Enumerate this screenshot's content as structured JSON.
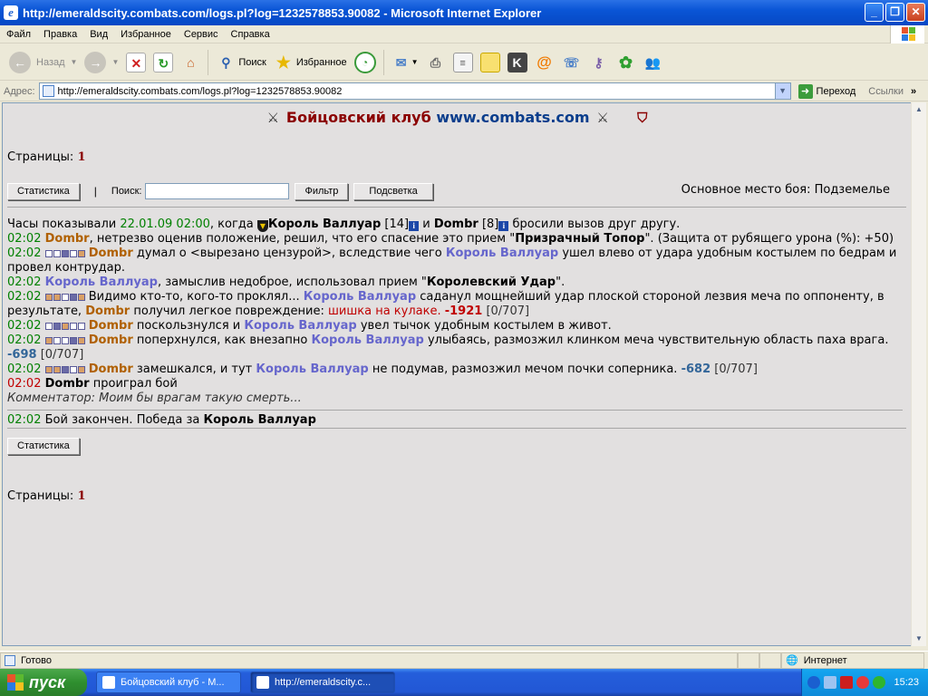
{
  "window": {
    "title": "http://emeraldscity.combats.com/logs.pl?log=1232578853.90082 - Microsoft Internet Explorer",
    "minimize": "_",
    "maximize": "❐",
    "close": "✕"
  },
  "menu": [
    "Файл",
    "Правка",
    "Вид",
    "Избранное",
    "Сервис",
    "Справка"
  ],
  "toolbar": {
    "back": "Назад",
    "search": "Поиск",
    "favorites": "Избранное"
  },
  "address": {
    "label": "Адрес:",
    "url": "http://emeraldscity.combats.com/logs.pl?log=1232578853.90082",
    "go": "Переход",
    "links": "Ссылки"
  },
  "page": {
    "header_club": "Бойцовский клуб",
    "header_site": "www.combats.com",
    "pages_label": "Страницы:",
    "pages_num": "1",
    "stats_button": "Статистика",
    "divider": "|",
    "search_label": "Поиск:",
    "search_value": "",
    "filter_button": "Фильтр",
    "highlight_button": "Подсветка",
    "place": "Основное место боя: Подземелье",
    "stats_button_bottom": "Статистика",
    "pages_label_bottom": "Страницы:",
    "pages_num_bottom": "1"
  },
  "log": {
    "intro": {
      "t1": "Часы показывали",
      "date": "22.01.09 02:00",
      "t2": ", когда",
      "player1": "Король Валлуар",
      "lvl1": "[14]",
      "and": "и",
      "player2": "Dombr",
      "lvl2": "[8]",
      "t3": "бросили вызов друг другу."
    },
    "l1": {
      "time": "02:02",
      "actor": "Dombr",
      "t1": ", нетрезво оценив положение, решил, что его спасение это прием \"",
      "skill": "Призрачный Топор",
      "t2": "\". (Защита от рубящего урона (%): +50)"
    },
    "l2": {
      "time": "02:02",
      "actor": "Dombr",
      "t1": "думал о <вырезано цензурой>, вследствие чего",
      "target": "Король Валлуар",
      "t2": "ушел влево от удара удобным костылем по бедрам и провел контрудар."
    },
    "l3": {
      "time": "02:02",
      "actor": "Король Валлуар",
      "t1": ", замыслив недоброе, использовал прием \"",
      "skill": "Королевский Удар",
      "t2": "\"."
    },
    "l4": {
      "time": "02:02",
      "t1": "Видимо кто-то, кого-то проклял...",
      "actor": "Король Валлуар",
      "t2": "саданул мощнейший удар плоской стороной лезвия меча по оппоненту, в результате,",
      "target": "Dombr",
      "t3": "получил легкое повреждение:",
      "injury": "шишка на кулаке.",
      "dmg": "-1921",
      "hp": "[0/707]"
    },
    "l5": {
      "time": "02:02",
      "actor": "Dombr",
      "t1": "поскользнулся и",
      "target": "Король Валлуар",
      "t2": "увел тычок удобным костылем в живот."
    },
    "l6": {
      "time": "02:02",
      "actor": "Dombr",
      "t1": "поперхнулся, как внезапно",
      "target": "Король Валлуар",
      "t2": "улыбаясь, размозжил клинком меча чувствительную область паха врага.",
      "dmg": "-698",
      "hp": "[0/707]"
    },
    "l7": {
      "time": "02:02",
      "actor": "Dombr",
      "t1": "замешкался, и тут",
      "target": "Король Валлуар",
      "t2": "не подумав, размозжил мечом почки соперника.",
      "dmg": "-682",
      "hp": "[0/707]"
    },
    "l8": {
      "time": "02:02",
      "actor": "Dombr",
      "t1": "проиграл бой"
    },
    "comment": "Комментатор: Моим бы врагам такую смерть...",
    "end": {
      "time": "02:02",
      "t1": "Бой закончен. Победа за",
      "winner": "Король Валлуар"
    }
  },
  "status": {
    "ready": "Готово",
    "zone": "Интернет"
  },
  "taskbar": {
    "start": "пуск",
    "task1": "Бойцовский клуб - М...",
    "task2": "http://emeraldscity.c...",
    "clock": "15:23"
  },
  "colors": {
    "accent": "#0a55d6",
    "player_orange": "#b06000",
    "player_blue": "#6666cc",
    "time_green": "#008000"
  }
}
